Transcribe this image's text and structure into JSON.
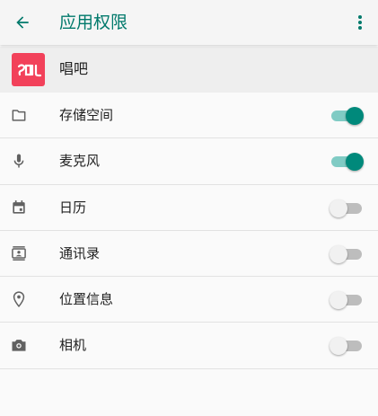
{
  "header": {
    "title": "应用权限",
    "back_icon": "arrow-left-icon",
    "menu_icon": "more-vert-icon",
    "accent_color": "#00796b"
  },
  "app": {
    "name": "唱吧",
    "logo_text": "唱吧",
    "logo_color": "#f2415a"
  },
  "permissions": [
    {
      "label": "存储空间",
      "icon": "folder-icon",
      "enabled": true
    },
    {
      "label": "麦克风",
      "icon": "microphone-icon",
      "enabled": true
    },
    {
      "label": "日历",
      "icon": "calendar-icon",
      "enabled": false
    },
    {
      "label": "通讯录",
      "icon": "contacts-icon",
      "enabled": false
    },
    {
      "label": "位置信息",
      "icon": "location-pin-icon",
      "enabled": false
    },
    {
      "label": "相机",
      "icon": "camera-icon",
      "enabled": false
    }
  ],
  "colors": {
    "toggle_on_thumb": "#00897b",
    "toggle_on_track": "#80cbc4",
    "toggle_off_thumb": "#f1f1f1",
    "toggle_off_track": "#bdbdbd"
  }
}
